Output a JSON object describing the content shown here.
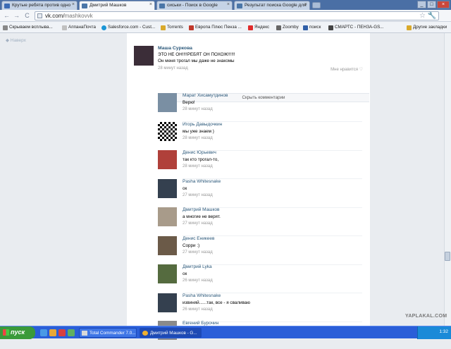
{
  "tabs": [
    {
      "title": "Крутые ребята против одно",
      "color": "#3b6bb5"
    },
    {
      "title": "Дмитрий Машков",
      "color": "#4a76a8"
    },
    {
      "title": "сиськи - Поиск в Google",
      "color": "#4a76a8"
    },
    {
      "title": "Результат поиска Google для",
      "color": "#4a76a8"
    }
  ],
  "toolbar": {
    "back": "←",
    "forward": "→",
    "reload": "C",
    "url_host": "vk.com/",
    "url_path": "mashkovvk",
    "star": "☆",
    "wrench": "🔧"
  },
  "window": {
    "minimize": "_",
    "maximize": "□",
    "close": "×"
  },
  "bookmarks": [
    {
      "label": "Скрываем всплыва...",
      "color": "#888888"
    },
    {
      "label": "АппанаПочта",
      "color": "#c0c0c0"
    },
    {
      "label": "Salesforce.com - Cust...",
      "color": "#1b96d6"
    },
    {
      "label": "Torrents",
      "color": "#d9a92b"
    },
    {
      "label": "Европа Плюс Пенза ...",
      "color": "#c0392b"
    },
    {
      "label": "Яндекс",
      "color": "#e02b2b"
    },
    {
      "label": "Zoomby",
      "color": "#666666"
    },
    {
      "label": "поиск",
      "color": "#2f5fa8"
    },
    {
      "label": "СМАРТС - ПЕНЗА-GS...",
      "color": "#444444"
    },
    {
      "label": "Другие закладки",
      "color": "#d9a92b"
    }
  ],
  "leftnav": {
    "label": "◆ Наверх"
  },
  "post": {
    "author": "Маша Суркова",
    "line1": "ЭТО НЕ ОН!!!!РЕБЯТ ОН ПОХОЖ!!!!!!",
    "line2": "Он меня трогал мы даже не знакомы",
    "time": "28 минут назад",
    "like": "Мне нравится ♡"
  },
  "hide_comments": "Скрыть комментарии",
  "comments": [
    {
      "name": "Марат Хисамутдинов",
      "text": "Верю!",
      "time": "28 минут назад",
      "avatar": "#7a8fa3"
    },
    {
      "name": "Игорь Давыдочкин",
      "text": "мы уже знаем )",
      "time": "28 минут назад",
      "avatar": "#222222"
    },
    {
      "name": "Денис Юрьевич",
      "text": "так кто трогал-то,",
      "time": "28 минут назад",
      "avatar": "#b0403a"
    },
    {
      "name": "Pasha Whitesnake",
      "text": "ок",
      "time": "27 минут назад",
      "avatar": "#34404f"
    },
    {
      "name": "Дмитрий Машков",
      "text": "а многие не верят.",
      "time": "27 минут назад",
      "avatar": "#a89b8a"
    },
    {
      "name": "Денис Еникеев",
      "text": "Сорри :)",
      "time": "27 минут назад",
      "avatar": "#6b5a48"
    },
    {
      "name": "Дмитрий Lyka",
      "text": "ок",
      "time": "26 минут назад",
      "avatar": "#556b3f"
    },
    {
      "name": "Pasha Whitesnake",
      "text": "извиняй......так, все - я сваливаю",
      "time": "26 минут назад",
      "avatar": "#34404f"
    },
    {
      "name": "Евгений Бурочин",
      "text": "",
      "time": "",
      "avatar": "#8a8a8a"
    }
  ],
  "taskbar": {
    "start": "пуск",
    "items": [
      {
        "label": "Total Commander 7.0...",
        "color": "#d8d8d8"
      },
      {
        "label": "Дмитрий Машков - G...",
        "color": "#f0b030"
      }
    ],
    "clock": "1:32"
  },
  "watermark": "YAPLAKAL.COM"
}
